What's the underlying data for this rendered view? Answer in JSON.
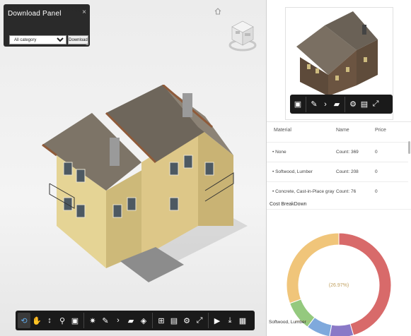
{
  "download_panel": {
    "title": "Download Panel",
    "close": "×",
    "category_value": "All category",
    "download_label": "Download"
  },
  "icons": {
    "home": "home-icon",
    "viewcube": "viewcube-icon"
  },
  "toolbar_icons": [
    "orbit-icon",
    "pan-icon",
    "zoom-icon",
    "walk-icon",
    "camera-icon",
    "explode-icon",
    "measure-icon",
    "section-icon",
    "folder-icon",
    "cube-icon",
    "structure-icon",
    "properties-icon",
    "settings-icon",
    "fullscreen-icon",
    "play-icon",
    "download-icon",
    "document-icon"
  ],
  "table": {
    "headers": {
      "material": "Material",
      "name": "Name",
      "price": "Price"
    },
    "rows": [
      {
        "material": "None",
        "name": "Count: 369",
        "price": "0"
      },
      {
        "material": "Softwood, Lumber",
        "name": "Count: 208",
        "price": "0"
      },
      {
        "material": "Concrete, Cast-in-Place gray",
        "name": "Count: 76",
        "price": "0"
      }
    ]
  },
  "cost": {
    "title": "Cost BreakDown",
    "center_label": "(26.97%)",
    "slice_label": "Softwood, Lumber"
  },
  "chart_data": {
    "type": "pie",
    "categories": [
      "Red",
      "Purple",
      "Blue",
      "Green",
      "Softwood, Lumber"
    ],
    "values": [
      40.0,
      6.5,
      6.5,
      8.0,
      26.97
    ],
    "colors": [
      "#d86a6a",
      "#8a79c7",
      "#7fa9dc",
      "#94c97e",
      "#f0c57a"
    ]
  },
  "colors": {
    "toolbar_bg": "#1a1a1a",
    "active_tool": "#5fa8e6"
  }
}
